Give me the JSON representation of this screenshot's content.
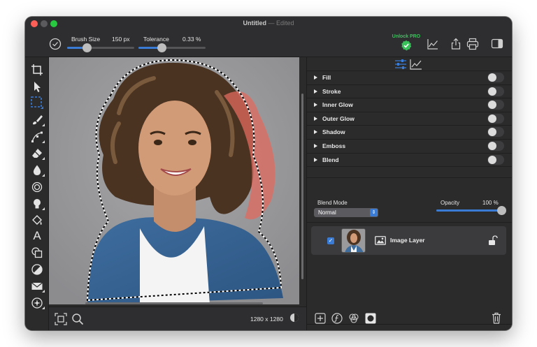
{
  "window": {
    "title": "Untitled",
    "title_suffix": "— Edited"
  },
  "toolbar": {
    "brush_size_label": "Brush Size",
    "brush_size_value": "150 px",
    "brush_size_fraction": 0.3,
    "tolerance_label": "Tolerance",
    "tolerance_value": "0.33 %",
    "tolerance_fraction": 0.35,
    "unlock_label": "Unlock PRO"
  },
  "tools": [
    "crop-icon",
    "pointer-icon",
    "marquee-select-icon",
    "brush-icon",
    "pen-tool-icon",
    "eraser-icon",
    "drop-icon",
    "blur-circle-icon",
    "lightbulb-icon",
    "fill-bucket-icon",
    "text-icon",
    "shapes-icon",
    "adjust-icon",
    "mail-icon",
    "magic-icon"
  ],
  "canvas": {
    "size_label": "1280 x 1280"
  },
  "panel": {
    "effects": [
      "Fill",
      "Stroke",
      "Inner Glow",
      "Outer Glow",
      "Shadow",
      "Emboss",
      "Blend"
    ],
    "blend_mode_label": "Blend Mode",
    "blend_mode_value": "Normal",
    "opacity_label": "Opacity",
    "opacity_value": "100 %",
    "opacity_fraction": 1.0,
    "layer_name": "Image Layer"
  },
  "colors": {
    "accent": "#3a7bd5",
    "pro_green": "#39c25a",
    "highlight": "#e06b5f"
  }
}
